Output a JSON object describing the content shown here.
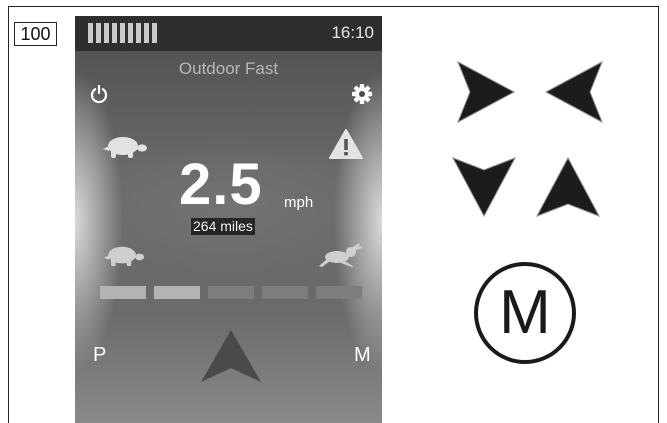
{
  "figure": {
    "label": "100"
  },
  "status_bar": {
    "time": "16:10",
    "battery_segments": 9
  },
  "display": {
    "mode_name": "Outdoor Fast",
    "speed_value": "2.5",
    "speed_unit": "mph",
    "odometer": "264 miles",
    "park_label": "P",
    "mode_label": "M",
    "speed_level_bars": {
      "total": 5,
      "active": 2
    },
    "colors": {
      "bar_active": "#b3b3b3",
      "bar_inactive": "#7d7d7d",
      "warning": "#e3e3e3"
    }
  },
  "icons": {
    "power": "power-icon",
    "settings": "gear-icon",
    "slow": "turtle-icon",
    "fast": "rabbit-icon",
    "warning": "warning-icon",
    "drive": "arrow-up-icon"
  },
  "buttons": {
    "horizontal_arrows": [
      "arrow-right-icon",
      "arrow-left-icon"
    ],
    "vertical_arrows": [
      "arrow-down-icon",
      "arrow-up-icon"
    ],
    "mode_button_label": "M"
  }
}
